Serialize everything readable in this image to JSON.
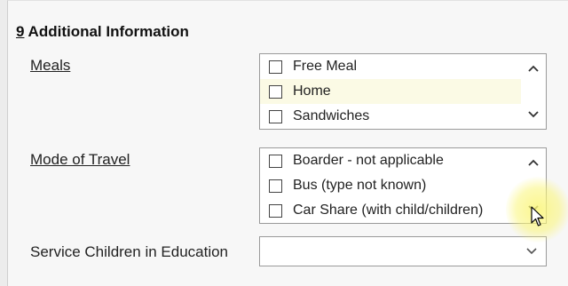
{
  "section": {
    "number": "9",
    "title": " Additional Information"
  },
  "meals": {
    "label": "Meals",
    "items": [
      "Free Meal",
      "Home",
      "Sandwiches"
    ]
  },
  "travel": {
    "label": "Mode of Travel",
    "items": [
      "Boarder - not applicable",
      "Bus (type not known)",
      "Car Share (with child/children)"
    ]
  },
  "service_children": {
    "label": "Service Children in Education",
    "value": ""
  },
  "icons": {
    "scroll_up": "chevron-up-icon",
    "scroll_down": "chevron-down-icon",
    "dropdown": "chevron-down-icon",
    "pointer": "mouse-pointer-icon"
  }
}
